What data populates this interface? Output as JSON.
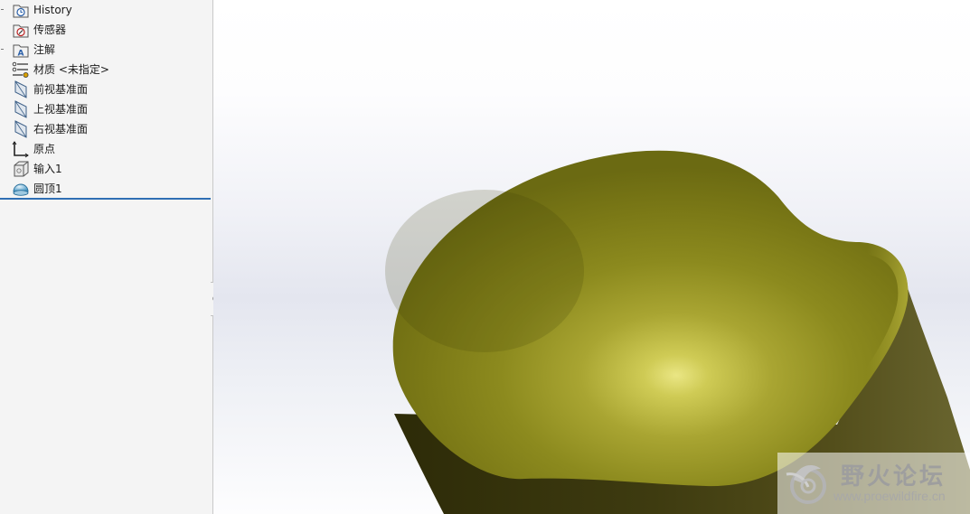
{
  "feature_tree": {
    "items": [
      {
        "label": "History",
        "icon": "history-folder-icon"
      },
      {
        "label": "传感器",
        "icon": "sensors-folder-icon"
      },
      {
        "label": "注解",
        "icon": "annotations-folder-icon"
      },
      {
        "label": "材质 <未指定>",
        "icon": "material-icon"
      },
      {
        "label": "前视基准面",
        "icon": "plane-icon"
      },
      {
        "label": "上视基准面",
        "icon": "plane-icon"
      },
      {
        "label": "右视基准面",
        "icon": "plane-icon"
      },
      {
        "label": "原点",
        "icon": "origin-icon"
      },
      {
        "label": "输入1",
        "icon": "imported-body-icon"
      },
      {
        "label": "圆顶1",
        "icon": "dome-feature-icon"
      }
    ]
  },
  "model": {
    "top_face_color": "#9c9a2a",
    "side_color": "#3f3c10"
  },
  "watermark": {
    "title": "野火论坛",
    "url": "www.proewildfire.cn"
  }
}
